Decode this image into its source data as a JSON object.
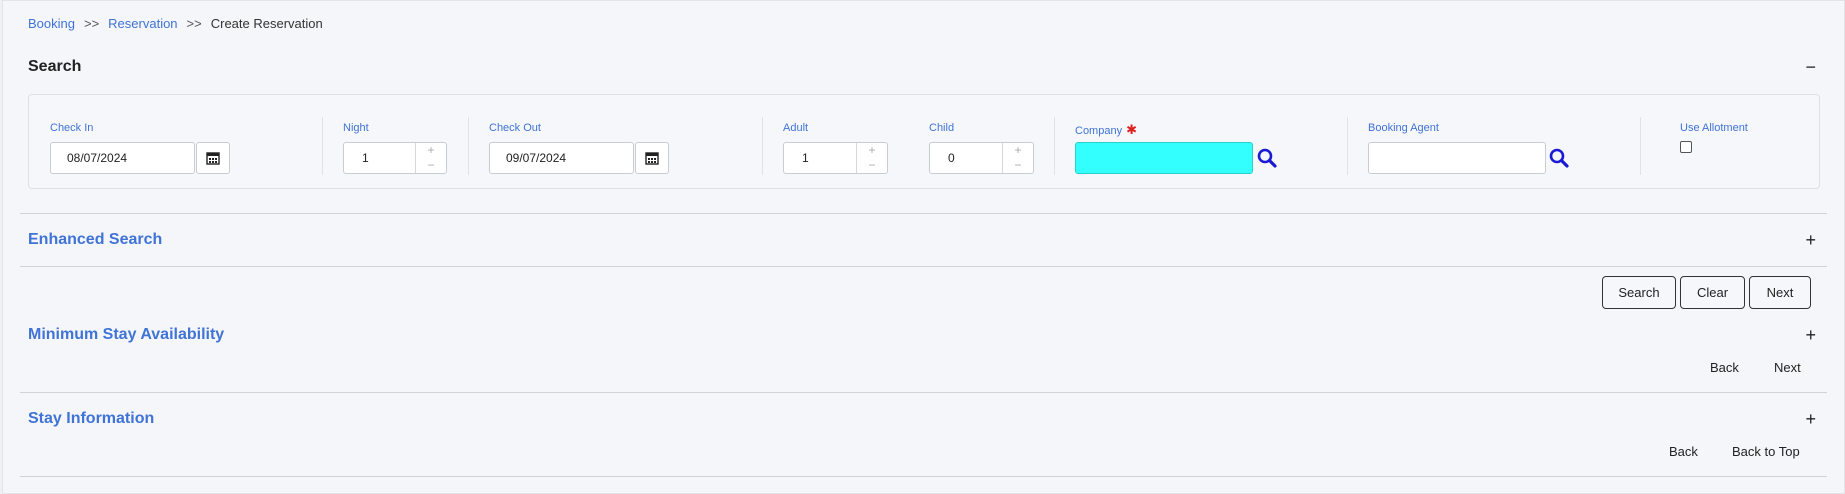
{
  "breadcrumb": {
    "items": [
      "Booking",
      "Reservation",
      "Create Reservation"
    ],
    "separator": ">>"
  },
  "search_section": {
    "title": "Search",
    "toggle": "−",
    "fields": {
      "check_in": {
        "label": "Check In",
        "value": "08/07/2024"
      },
      "night": {
        "label": "Night",
        "value": "1"
      },
      "check_out": {
        "label": "Check Out",
        "value": "09/07/2024"
      },
      "adult": {
        "label": "Adult",
        "value": "1"
      },
      "child": {
        "label": "Child",
        "value": "0"
      },
      "company": {
        "label": "Company",
        "required_mark": "✱",
        "value": ""
      },
      "booking_agent": {
        "label": "Booking Agent",
        "value": ""
      },
      "use_allotment": {
        "label": "Use Allotment",
        "checked": false
      }
    },
    "spin_up": "+",
    "spin_down": "−"
  },
  "enhanced_search": {
    "title": "Enhanced Search",
    "toggle": "+"
  },
  "actions": {
    "search": "Search",
    "clear": "Clear",
    "next": "Next"
  },
  "min_stay": {
    "title": "Minimum Stay Availability",
    "toggle": "+",
    "back": "Back",
    "next": "Next"
  },
  "stay_info": {
    "title": "Stay Information",
    "toggle": "+",
    "back": "Back",
    "back_to_top": "Back to Top"
  },
  "colors": {
    "accent": "#3f73d7",
    "company_highlight": "#33ffff",
    "search_icon": "#1a1ad6",
    "required": "#e02020"
  }
}
